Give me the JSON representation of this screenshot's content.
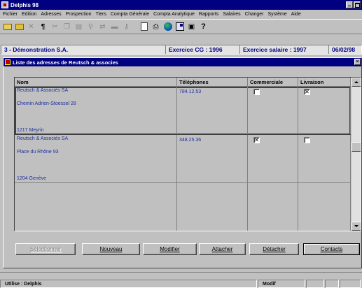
{
  "window": {
    "title": "Delphis 98"
  },
  "menu": [
    "Fichier",
    "Edition",
    "Adresses",
    "Prospection",
    "Tiers",
    "Compta Générale",
    "Compta Analytique",
    "Rapports",
    "Salaires",
    "Changer",
    "Système",
    "Aide"
  ],
  "info": {
    "company": "3 - Démonstration S.A.",
    "exercise_cg": "Exercice CG : 1996",
    "exercise_salary": "Exercice salaire :  1997",
    "date": "06/02/98"
  },
  "child": {
    "title": "Liste des adresses de Reutsch & associes"
  },
  "table": {
    "headers": {
      "name": "Nom",
      "phones": "Téléphones",
      "commercial": "Commerciale",
      "delivery": "Livraison"
    },
    "rows": [
      {
        "name": "Reutsch & Associés SA",
        "street": "Chemin Adrien-Stoessel 28",
        "city": "1217 Meyrin",
        "phone": "784.12.53",
        "commercial": false,
        "delivery": true
      },
      {
        "name": "Reutsch & Associés SA",
        "street": "Place du Rhône 93",
        "city": "1204 Genève",
        "phone": "348.25.36",
        "commercial": true,
        "delivery": false
      }
    ]
  },
  "buttons": {
    "select": "Sélectionner",
    "new": "Nouveau",
    "modify": "Modifier",
    "attach": "Attacher",
    "detach": "Détacher",
    "contacts": "Contacts"
  },
  "status": {
    "user": "Utilise : Delphis",
    "mode": "Modif"
  },
  "toolbar_icons": [
    "open-folder-icon",
    "folder-icon",
    "cut-x-icon",
    "paragraph-icon",
    "scissors-icon",
    "copy-icon",
    "paste-icon",
    "find-icon",
    "replace-icon",
    "delete-icon",
    "key-icon",
    "document-icon",
    "printer-icon",
    "globe-icon",
    "edit-document-icon",
    "print-icon",
    "help-icon"
  ]
}
